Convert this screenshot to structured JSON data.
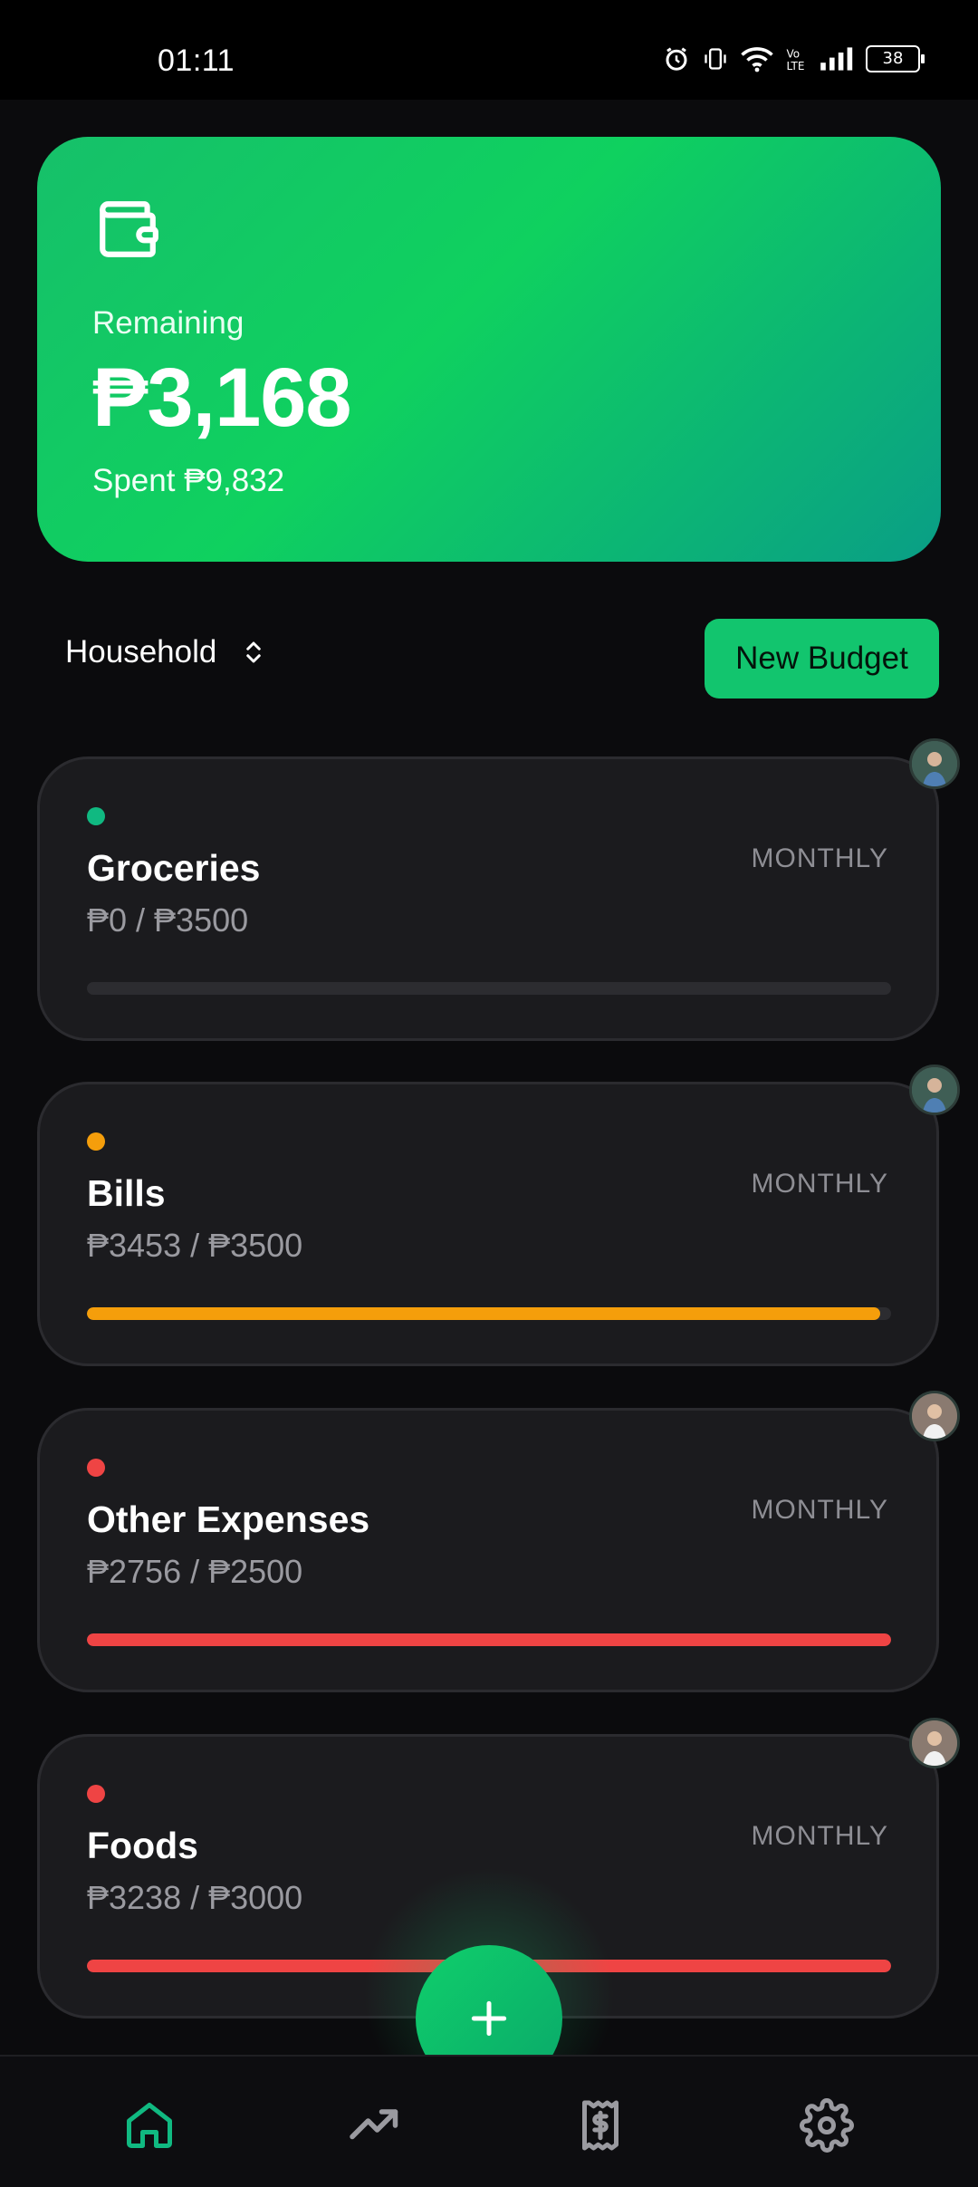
{
  "status_bar": {
    "time": "01:11",
    "battery": "38"
  },
  "summary": {
    "remaining_label": "Remaining",
    "remaining_amount": "₱3,168",
    "spent_text": "Spent ₱9,832"
  },
  "selector": {
    "household_label": "Household",
    "new_budget_label": "New Budget"
  },
  "budgets": [
    {
      "name": "Groceries",
      "amount": "₱0 / ₱3500",
      "period": "MONTHLY",
      "color": "#10b981",
      "progress": 0.0
    },
    {
      "name": "Bills",
      "amount": "₱3453 / ₱3500",
      "period": "MONTHLY",
      "color": "#f59e0b",
      "progress": 0.987
    },
    {
      "name": "Other Expenses",
      "amount": "₱2756 / ₱2500",
      "period": "MONTHLY",
      "color": "#ef4444",
      "progress": 1.0
    },
    {
      "name": "Foods",
      "amount": "₱3238 / ₱3000",
      "period": "MONTHLY",
      "color": "#ef4444",
      "progress": 1.0
    }
  ],
  "nav": {
    "items": [
      {
        "icon": "home-icon",
        "active": true
      },
      {
        "icon": "trending-icon",
        "active": false
      },
      {
        "icon": "receipt-icon",
        "active": false
      },
      {
        "icon": "settings-icon",
        "active": false
      }
    ],
    "active_color": "#10b981",
    "inactive_color": "#9a9aa0"
  }
}
